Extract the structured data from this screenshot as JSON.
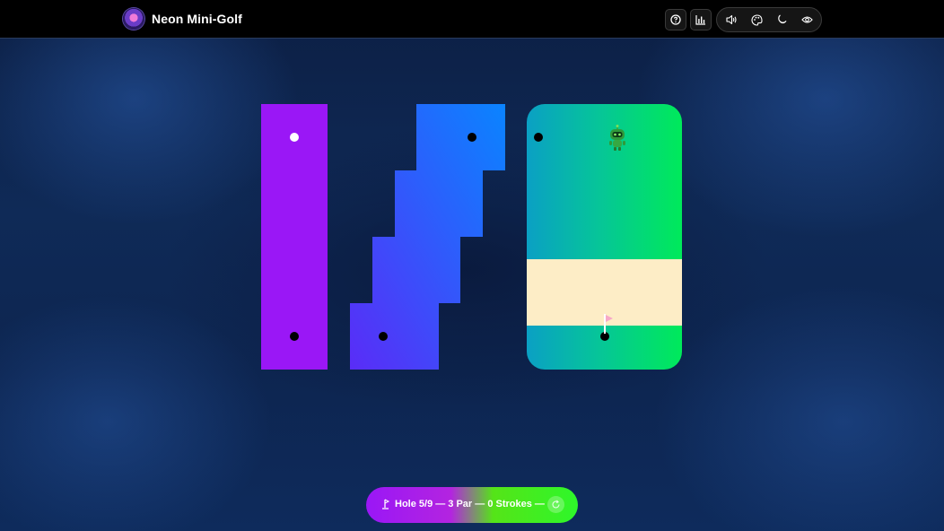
{
  "app": {
    "title": "Neon Mini-Golf",
    "logo_icon": "neon-golf-logo-icon"
  },
  "toolbar": {
    "help_icon": "question-circle-icon",
    "stats_icon": "bar-chart-icon",
    "sound_icon": "speaker-icon",
    "palette_icon": "palette-icon",
    "theme_icon": "moon-icon",
    "view_icon": "eye-icon"
  },
  "course": {
    "colors": {
      "lane": "#9a17f6",
      "stair_gradient_start": "#5a2cf7",
      "stair_gradient_end": "#0a84ff",
      "green_left": "#0aa0c4",
      "green_right": "#00ea5a",
      "sand": "#fdedc6"
    },
    "flag_icon": "pink-flag-icon",
    "character_icon": "green-robot-icon"
  },
  "hud": {
    "text": "Hole 5/9 — 3 Par — 0 Strokes —",
    "hole_current": 5,
    "hole_total": 9,
    "par": 3,
    "strokes": 0,
    "icon": "golf-tee-icon",
    "reset_icon": "reset-icon",
    "gradient_start": "#9a17f6",
    "gradient_end": "#2ef72a"
  }
}
